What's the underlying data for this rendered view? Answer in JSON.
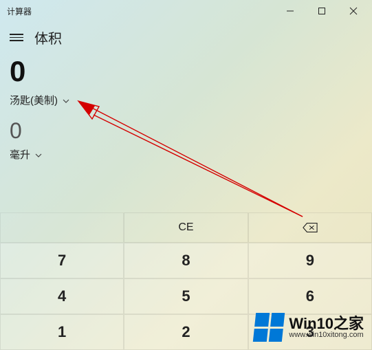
{
  "titlebar": {
    "title": "计算器"
  },
  "header": {
    "page_title": "体积"
  },
  "input": {
    "value": "0",
    "unit_label": "汤匙(美制)"
  },
  "output": {
    "value": "0",
    "unit_label": "毫升"
  },
  "keypad": {
    "ce": "CE",
    "keys": {
      "7": "7",
      "8": "8",
      "9": "9",
      "4": "4",
      "5": "5",
      "6": "6",
      "1": "1",
      "2": "2",
      "3": "3"
    }
  },
  "watermark": {
    "main": "Win10之家",
    "sub": "www.win10xitong.com"
  }
}
